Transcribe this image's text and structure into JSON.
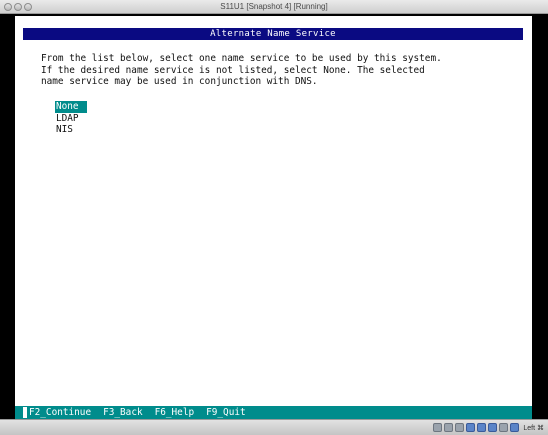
{
  "window": {
    "title": "S11U1 [Snapshot 4] [Running]"
  },
  "installer": {
    "title": "Alternate Name Service",
    "instructions": [
      "From the list below, select one name service to be used by this system.",
      "If the desired name service is not listed, select None. The selected",
      "name service may be used in conjunction with DNS."
    ],
    "options": [
      {
        "label": "None",
        "selected": true
      },
      {
        "label": "LDAP",
        "selected": false
      },
      {
        "label": "NIS",
        "selected": false
      }
    ],
    "function_keys": [
      "F2_Continue",
      "F3_Back",
      "F6_Help",
      "F9_Quit"
    ]
  },
  "statusbar": {
    "icons": [
      "hdd-icon",
      "cd-icon",
      "floppy-icon",
      "network-icon",
      "usb-icon",
      "shared-folder-icon",
      "display-icon",
      "mouse-icon"
    ],
    "host_key_label": "Left ⌘"
  },
  "colors": {
    "title_bar": "#0a0a82",
    "highlight": "#008c8c",
    "screen_bg": "#ffffff",
    "border": "#000000"
  }
}
